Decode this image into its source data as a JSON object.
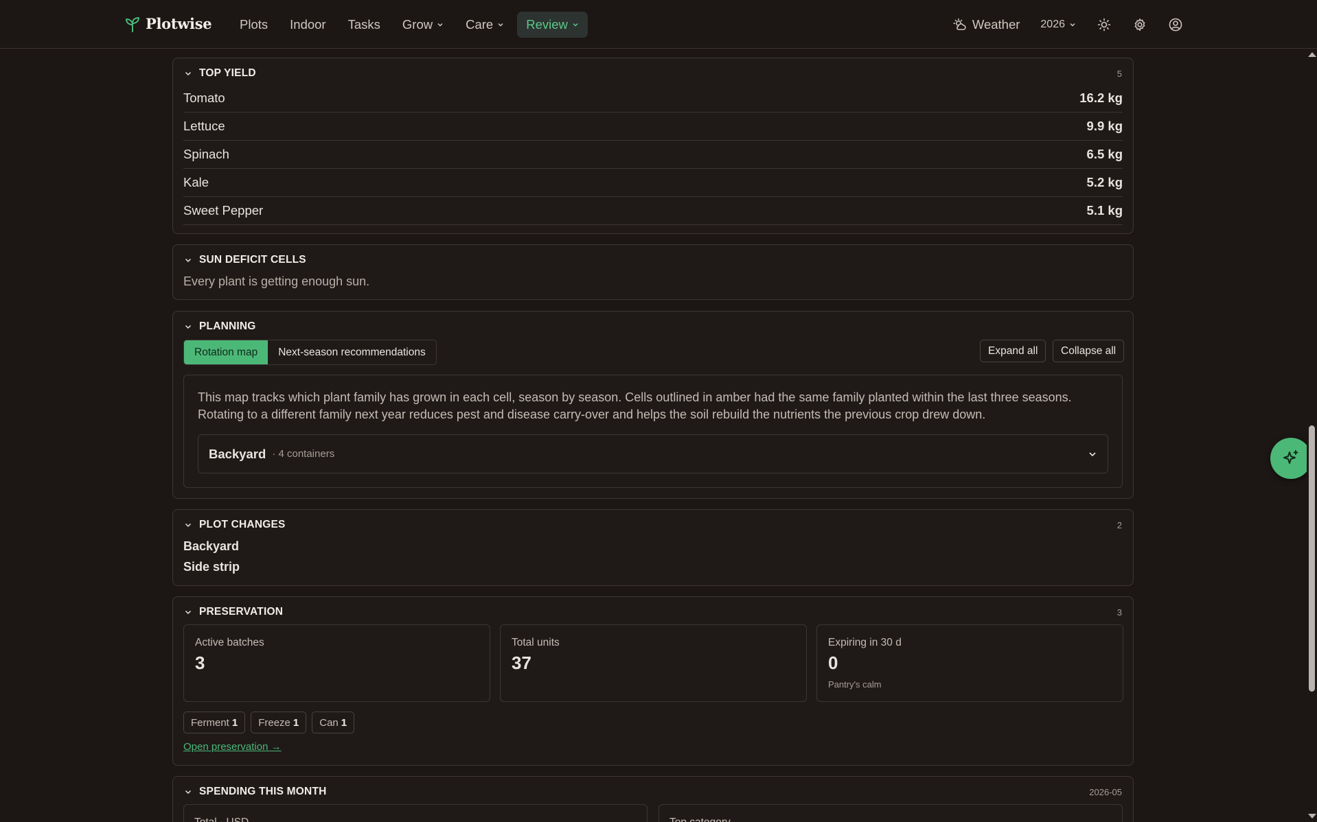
{
  "brand": {
    "name": "Plotwise",
    "accent": "#4cb878"
  },
  "nav": {
    "items": [
      {
        "label": "Plots",
        "dropdown": false,
        "active": false
      },
      {
        "label": "Indoor",
        "dropdown": false,
        "active": false
      },
      {
        "label": "Tasks",
        "dropdown": false,
        "active": false
      },
      {
        "label": "Grow",
        "dropdown": true,
        "active": false
      },
      {
        "label": "Care",
        "dropdown": true,
        "active": false
      },
      {
        "label": "Review",
        "dropdown": true,
        "active": true
      }
    ],
    "weather_label": "Weather",
    "year": "2026",
    "icons": [
      "weather-icon",
      "theme-sun-icon",
      "settings-gear-icon",
      "account-icon"
    ]
  },
  "top_yield": {
    "title": "TOP YIELD",
    "count": "5",
    "rows": [
      {
        "name": "Tomato",
        "value": "16.2 kg"
      },
      {
        "name": "Lettuce",
        "value": "9.9 kg"
      },
      {
        "name": "Spinach",
        "value": "6.5 kg"
      },
      {
        "name": "Kale",
        "value": "5.2 kg"
      },
      {
        "name": "Sweet Pepper",
        "value": "5.1 kg"
      }
    ]
  },
  "sun_deficit": {
    "title": "SUN DEFICIT CELLS",
    "message": "Every plant is getting enough sun."
  },
  "planning": {
    "title": "PLANNING",
    "tabs": [
      {
        "label": "Rotation map",
        "selected": true
      },
      {
        "label": "Next-season recommendations",
        "selected": false
      }
    ],
    "expand_all": "Expand all",
    "collapse_all": "Collapse all",
    "description_line1": "This map tracks which plant family has grown in each cell, season by season. Cells outlined in amber had the same family planted within the last three seasons.",
    "description_line2": "Rotating to a different family next year reduces pest and disease carry-over and helps the soil rebuild the nutrients the previous crop drew down.",
    "plot": {
      "name": "Backyard",
      "meta": "· 4 containers"
    }
  },
  "plot_changes": {
    "title": "PLOT CHANGES",
    "count": "2",
    "items": [
      "Backyard",
      "Side strip"
    ]
  },
  "preservation": {
    "title": "PRESERVATION",
    "count": "3",
    "stats": [
      {
        "label": "Active batches",
        "value": "3",
        "note": ""
      },
      {
        "label": "Total units",
        "value": "37",
        "note": ""
      },
      {
        "label": "Expiring in 30 d",
        "value": "0",
        "note": "Pantry's calm"
      }
    ],
    "chips": [
      {
        "label": "Ferment",
        "count": "1"
      },
      {
        "label": "Freeze",
        "count": "1"
      },
      {
        "label": "Can",
        "count": "1"
      }
    ],
    "link": "Open preservation →"
  },
  "spending": {
    "title": "SPENDING THIS MONTH",
    "period": "2026-05",
    "boxes": [
      "Total · USD",
      "Top category"
    ]
  }
}
